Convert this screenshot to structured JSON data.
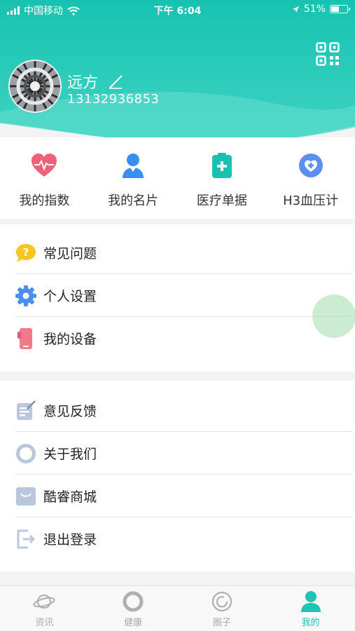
{
  "status_bar": {
    "carrier": "中国移动",
    "time": "下午 6:04",
    "battery": "51%",
    "battery_level": 0.51
  },
  "colors": {
    "brand": "#1cc4b2",
    "brand_light": "#6fe0d0",
    "active_tab": "#1fc4b5"
  },
  "profile": {
    "name": "远方",
    "phone": "13132936853"
  },
  "quick_menu": [
    {
      "label": "我的指数",
      "icon": "heart-pulse-icon"
    },
    {
      "label": "我的名片",
      "icon": "person-card-icon"
    },
    {
      "label": "医疗单据",
      "icon": "medical-document-icon"
    },
    {
      "label": "H3血压计",
      "icon": "blood-pressure-icon"
    }
  ],
  "menu_group_1": [
    {
      "label": "常见问题",
      "icon": "question-bubble-icon"
    },
    {
      "label": "个人设置",
      "icon": "gear-icon"
    },
    {
      "label": "我的设备",
      "icon": "phone-device-icon"
    }
  ],
  "menu_group_2": [
    {
      "label": "意见反馈",
      "icon": "feedback-edit-icon"
    },
    {
      "label": "关于我们",
      "icon": "ring-icon"
    },
    {
      "label": "酷睿商城",
      "icon": "shop-bag-icon"
    },
    {
      "label": "退出登录",
      "icon": "logout-icon"
    }
  ],
  "tabbar": [
    {
      "label": "资讯",
      "icon": "planet-icon",
      "active": false
    },
    {
      "label": "健康",
      "icon": "health-ring-icon",
      "active": false
    },
    {
      "label": "圈子",
      "icon": "circle-smile-icon",
      "active": false
    },
    {
      "label": "我的",
      "icon": "user-icon",
      "active": true
    }
  ]
}
